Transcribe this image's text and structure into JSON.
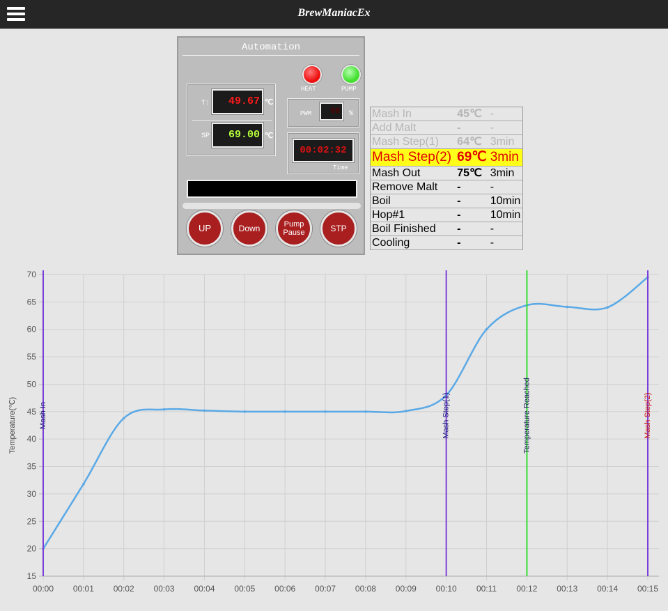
{
  "app": {
    "title": "BrewManiacEx"
  },
  "panel": {
    "title": "Automation",
    "heat_label": "HEAT",
    "pump_label": "PUMP",
    "temp_label": "T:",
    "temp_value": "49.67",
    "temp_unit": "℃",
    "sp_label": "SP",
    "sp_value": "69.00",
    "sp_unit": "℃",
    "pwm_label": "PWM",
    "pwm_value": "00",
    "pwm_unit": "%",
    "timer_value": "00:02:32",
    "time_label": "Time",
    "message": ""
  },
  "buttons": {
    "up": "UP",
    "down": "Down",
    "pump_pause_1": "Pump",
    "pump_pause_2": "Pause",
    "stp": "STP"
  },
  "colors": {
    "temp_red": "#ff1a1a",
    "sp_green": "#b6ff3a",
    "line_blue": "#5aa9e6",
    "marker_purple": "#7a3fd8",
    "marker_green": "#33dd33",
    "active_step_bg": "#ffff1a"
  },
  "steps": [
    {
      "name": "Mash In",
      "temp": "45℃",
      "time": "-",
      "state": "done"
    },
    {
      "name": "Add Malt",
      "temp": "-",
      "time": "-",
      "state": "done"
    },
    {
      "name": "Mash Step(1)",
      "temp": "64℃",
      "time": "3min",
      "state": "done"
    },
    {
      "name": "Mash Step(2)",
      "temp": "69℃",
      "time": "3min",
      "state": "active"
    },
    {
      "name": "Mash Out",
      "temp": "75℃",
      "time": "3min",
      "state": "pending"
    },
    {
      "name": "Remove Malt",
      "temp": "-",
      "time": "-",
      "state": "pending"
    },
    {
      "name": "Boil",
      "temp": "-",
      "time": "10min",
      "state": "pending"
    },
    {
      "name": "Hop#1",
      "temp": "-",
      "time": "10min",
      "state": "pending"
    },
    {
      "name": "Boil Finished",
      "temp": "-",
      "time": "-",
      "state": "pending"
    },
    {
      "name": "Cooling",
      "temp": "-",
      "time": "-",
      "state": "pending"
    }
  ],
  "chart_data": {
    "type": "line",
    "ylabel": "Temperature(℃)",
    "ylim": [
      15,
      70
    ],
    "yticks": [
      15,
      20,
      25,
      30,
      35,
      40,
      45,
      50,
      55,
      60,
      65,
      70
    ],
    "xlim": [
      "00:00",
      "00:15"
    ],
    "xticks": [
      "00:00",
      "00:01",
      "00:02",
      "00:03",
      "00:04",
      "00:05",
      "00:06",
      "00:07",
      "00:08",
      "00:09",
      "00:10",
      "00:11",
      "00:12",
      "00:13",
      "00:14",
      "00:15"
    ],
    "grid": true,
    "series": [
      {
        "values": [
          [
            "00:00",
            20
          ],
          [
            "00:01",
            31.8
          ],
          [
            "00:02",
            43.8
          ],
          [
            "00:03",
            45.4
          ],
          [
            "00:04",
            45.2
          ],
          [
            "00:05",
            45.0
          ],
          [
            "00:06",
            45.0
          ],
          [
            "00:07",
            45.0
          ],
          [
            "00:08",
            45.0
          ],
          [
            "00:09",
            45.1
          ],
          [
            "00:10",
            48.0
          ],
          [
            "00:11",
            60.0
          ],
          [
            "00:12",
            64.4
          ],
          [
            "00:13",
            64.1
          ],
          [
            "00:14",
            64.0
          ],
          [
            "00:15",
            69.5
          ]
        ]
      }
    ],
    "annotations": [
      {
        "x": "00:00",
        "label": "Mash In",
        "color": "#7a3fd8",
        "text_color": "#1a1a7a"
      },
      {
        "x": "00:10",
        "label": "Mash Step(1)",
        "color": "#7a3fd8",
        "text_color": "#1a1a7a"
      },
      {
        "x": "00:12",
        "label": "Temperature Reached",
        "color": "#33dd33",
        "text_color": "#1a1a5a"
      },
      {
        "x": "00:15",
        "label": "Mash Step(2)",
        "color": "#7a3fd8",
        "text_color": "#cc1111"
      }
    ]
  }
}
